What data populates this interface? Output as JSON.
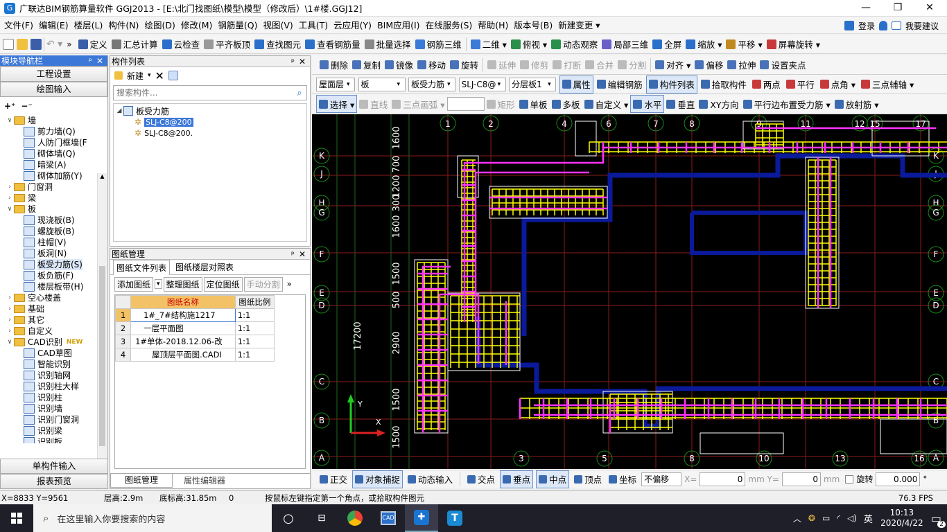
{
  "app": {
    "title": "广联达BIM钢筋算量软件 GGJ2013 - [E:\\北门找图纸\\模型\\模型（修改后）\\1#楼.GGJ12]"
  },
  "window_controls": {
    "minimize": "—",
    "restore": "❐",
    "close": "✕"
  },
  "menu": [
    "文件(F)",
    "编辑(E)",
    "楼层(L)",
    "构件(N)",
    "绘图(D)",
    "修改(M)",
    "钢筋量(Q)",
    "视图(V)",
    "工具(T)",
    "云应用(Y)",
    "BIM应用(I)",
    "在线服务(S)",
    "帮助(H)",
    "版本号(B)",
    "新建变更 ▾"
  ],
  "menu_right": {
    "login": "登录",
    "suggest": "我要建议"
  },
  "toolbar1": [
    "定义",
    "汇总计算",
    "云检查",
    "平齐板顶",
    "查找图元",
    "查看钢筋量",
    "批量选择",
    "钢筋三维",
    "二维 ▾",
    "俯视 ▾",
    "动态观察",
    "局部三维",
    "全屏",
    "缩放 ▾",
    "平移 ▾",
    "屏幕旋转 ▾"
  ],
  "toolbar2": [
    "删除",
    "复制",
    "镜像",
    "移动",
    "旋转",
    "延伸",
    "修剪",
    "打断",
    "合并",
    "分割",
    "对齐 ▾",
    "偏移",
    "拉伸",
    "设置夹点"
  ],
  "toolbar3": {
    "floor": "屋面层",
    "type": "板",
    "sub": "板受力筋",
    "spec": "SLJ-C8@",
    "layer": "分层板1",
    "buttons": [
      "属性",
      "编辑钢筋",
      "构件列表",
      "拾取构件",
      "两点",
      "平行",
      "点角 ▾",
      "三点辅轴 ▾"
    ]
  },
  "toolbar4": [
    "选择 ▾",
    "直线",
    "三点画弧 ▾",
    "矩形",
    "单板",
    "多板",
    "自定义 ▾",
    "水平",
    "垂直",
    "XY方向",
    "平行边布置受力筋 ▾",
    "放射筋 ▾"
  ],
  "nav": {
    "title": "模块导航栏",
    "btn_engineering": "工程设置",
    "btn_draw": "绘图输入",
    "btn_single": "单构件输入",
    "btn_report": "报表预览",
    "tree": [
      {
        "lvl": 0,
        "open": true,
        "folder": true,
        "label": "墙"
      },
      {
        "lvl": 1,
        "label": "剪力墙(Q)"
      },
      {
        "lvl": 1,
        "label": "人防门框墙(F"
      },
      {
        "lvl": 1,
        "label": "砌体墙(Q)"
      },
      {
        "lvl": 1,
        "label": "暗梁(A)"
      },
      {
        "lvl": 1,
        "label": "砌体加筋(Y)"
      },
      {
        "lvl": 0,
        "open": false,
        "folder": true,
        "label": "门窗洞"
      },
      {
        "lvl": 0,
        "open": false,
        "folder": true,
        "label": "梁"
      },
      {
        "lvl": 0,
        "open": true,
        "folder": true,
        "label": "板"
      },
      {
        "lvl": 1,
        "label": "现浇板(B)"
      },
      {
        "lvl": 1,
        "label": "螺旋板(B)"
      },
      {
        "lvl": 1,
        "label": "柱帽(V)"
      },
      {
        "lvl": 1,
        "label": "板洞(N)"
      },
      {
        "lvl": 1,
        "label": "板受力筋(S)",
        "sel": true
      },
      {
        "lvl": 1,
        "label": "板负筋(F)"
      },
      {
        "lvl": 1,
        "label": "楼层板带(H)"
      },
      {
        "lvl": 0,
        "open": false,
        "folder": true,
        "label": "空心楼盖"
      },
      {
        "lvl": 0,
        "open": false,
        "folder": true,
        "label": "基础"
      },
      {
        "lvl": 0,
        "open": false,
        "folder": true,
        "label": "其它"
      },
      {
        "lvl": 0,
        "open": false,
        "folder": true,
        "label": "自定义"
      },
      {
        "lvl": 0,
        "open": true,
        "folder": true,
        "label": "CAD识别",
        "badge": "NEW"
      },
      {
        "lvl": 1,
        "label": "CAD草图"
      },
      {
        "lvl": 1,
        "label": "智能识别"
      },
      {
        "lvl": 1,
        "label": "识别轴网"
      },
      {
        "lvl": 1,
        "label": "识别柱大样"
      },
      {
        "lvl": 1,
        "label": "识别柱"
      },
      {
        "lvl": 1,
        "label": "识别墙"
      },
      {
        "lvl": 1,
        "label": "识别门窗洞"
      },
      {
        "lvl": 1,
        "label": "识别梁"
      },
      {
        "lvl": 1,
        "label": "识别板"
      }
    ]
  },
  "complist": {
    "title": "构件列表",
    "new": "新建",
    "search_placeholder": "搜索构件...",
    "group": "板受力筋",
    "items": [
      "SLJ-C8@200",
      "SLJ-C8@200."
    ]
  },
  "drawmgr": {
    "title": "图纸管理",
    "tabs": [
      "图纸文件列表",
      "图纸楼层对照表"
    ],
    "btns": [
      "添加图纸",
      "整理图纸",
      "定位图纸",
      "手动分割"
    ],
    "headers": [
      "图纸名称",
      "图纸比例"
    ],
    "rows": [
      {
        "no": "1",
        "name": "1#_7#结构施1217",
        "scale": "1:1"
      },
      {
        "no": "2",
        "name": "一层平面图",
        "scale": "1:1"
      },
      {
        "no": "3",
        "name": "1#单体-2018.12.06-改",
        "scale": "1:1"
      },
      {
        "no": "4",
        "name": "屋顶层平面图.CADI",
        "scale": "1:1"
      }
    ],
    "bottom_tabs": [
      "图纸管理",
      "属性编辑器"
    ]
  },
  "canvas": {
    "top_axes": [
      "1",
      "2",
      "4",
      "6",
      "7",
      "8",
      "9",
      "11",
      "12",
      "15",
      "17"
    ],
    "bottom_axes": [
      "3",
      "5",
      "8",
      "10",
      "13",
      "16"
    ],
    "left_axes": [
      "K",
      "J",
      "H",
      "G",
      "F",
      "E",
      "D",
      "C",
      "B",
      "A"
    ],
    "dims": [
      "1600",
      "700",
      "1200",
      "300",
      "1600",
      "1500",
      "500",
      "2900",
      "1500",
      "1500"
    ],
    "total": "17200",
    "xlabel": "X",
    "ylabel": "Y"
  },
  "snapbar": {
    "items": [
      "正交",
      "对象捕捉",
      "动态输入",
      "交点",
      "垂点",
      "中点",
      "顶点",
      "坐标"
    ],
    "offset": "不偏移",
    "x_label": "X=",
    "x_val": "0",
    "y_label": "mm Y=",
    "y_val": "0",
    "mm": "mm",
    "rotate": "旋转",
    "rot_val": "0.000",
    "deg": "°"
  },
  "status": {
    "coord": "X=8833 Y=9561",
    "floor_h": "层高:2.9m",
    "base_h": "底标高:31.85m",
    "zero": "0",
    "hint": "按鼠标左键指定第一个角点，或拾取构件图元",
    "fps": "76.3 FPS"
  },
  "taskbar": {
    "search": "在这里输入你要搜索的内容",
    "time": "10:13",
    "date": "2020/4/22",
    "ime": "英",
    "notif": "2"
  }
}
